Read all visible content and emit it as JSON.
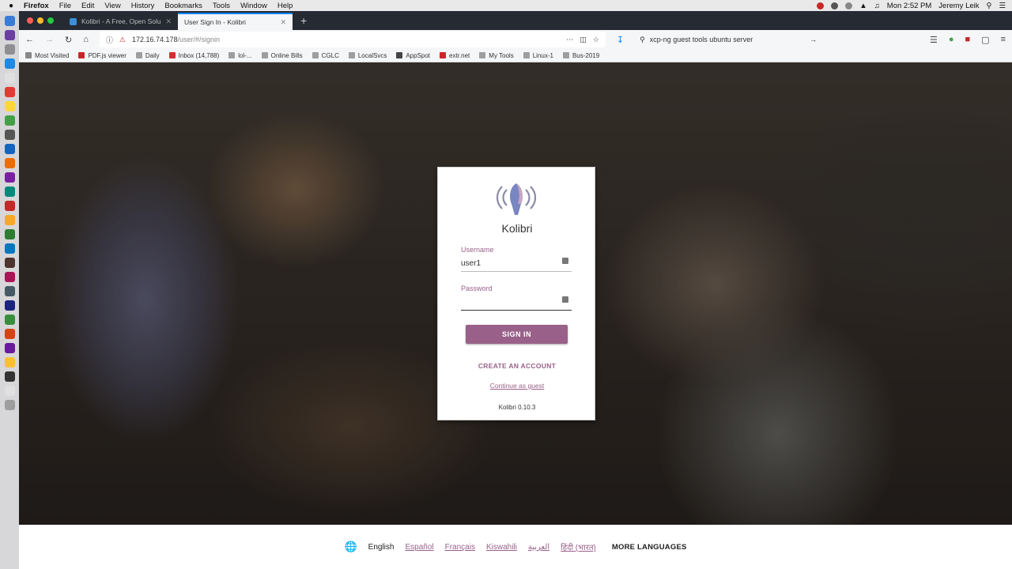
{
  "menubar": {
    "app": "Firefox",
    "items": [
      "File",
      "Edit",
      "View",
      "History",
      "Bookmarks",
      "Tools",
      "Window",
      "Help"
    ],
    "clock": "Mon 2:52 PM",
    "user": "Jeremy Leik"
  },
  "tabs": [
    {
      "title": "Kolibri - A Free, Open Solutio...",
      "active": false
    },
    {
      "title": "User Sign In - Kolibri",
      "active": true
    }
  ],
  "toolbar": {
    "url_host": "172.16.74.178",
    "url_path": "/user/#/signin",
    "search_text": "xcp-ng guest tools ubuntu server"
  },
  "bookmarks": [
    {
      "label": "Most Visited",
      "color": "#888888"
    },
    {
      "label": "PDF.js viewer",
      "color": "#c62828"
    },
    {
      "label": "Daily",
      "color": "#9e9e9e"
    },
    {
      "label": "Inbox (14,788)",
      "color": "#d32f2f"
    },
    {
      "label": "lol-...",
      "color": "#9e9e9e"
    },
    {
      "label": "Online Bills",
      "color": "#9e9e9e"
    },
    {
      "label": "CGLC",
      "color": "#9e9e9e"
    },
    {
      "label": "LocalSvcs",
      "color": "#9e9e9e"
    },
    {
      "label": "AppSpot",
      "color": "#444444"
    },
    {
      "label": "extr.net",
      "color": "#c62828"
    },
    {
      "label": "My Tools",
      "color": "#9e9e9e"
    },
    {
      "label": "Linux-1",
      "color": "#9e9e9e"
    },
    {
      "label": "Bus-2019",
      "color": "#9e9e9e"
    }
  ],
  "login": {
    "app_name": "Kolibri",
    "username_label": "Username",
    "username_value": "user1",
    "password_label": "Password",
    "signin_label": "SIGN IN",
    "create_account_label": "CREATE AN ACCOUNT",
    "guest_label": "Continue as guest",
    "version": "Kolibri 0.10.3"
  },
  "languages": {
    "current": "English",
    "options": [
      "Español",
      "Français",
      "Kiswahili",
      "العربية",
      "हिंदी (भारत)"
    ],
    "more_label": "MORE LANGUAGES"
  },
  "colors": {
    "brand": "#996189",
    "tab_accent": "#0a84ff"
  }
}
